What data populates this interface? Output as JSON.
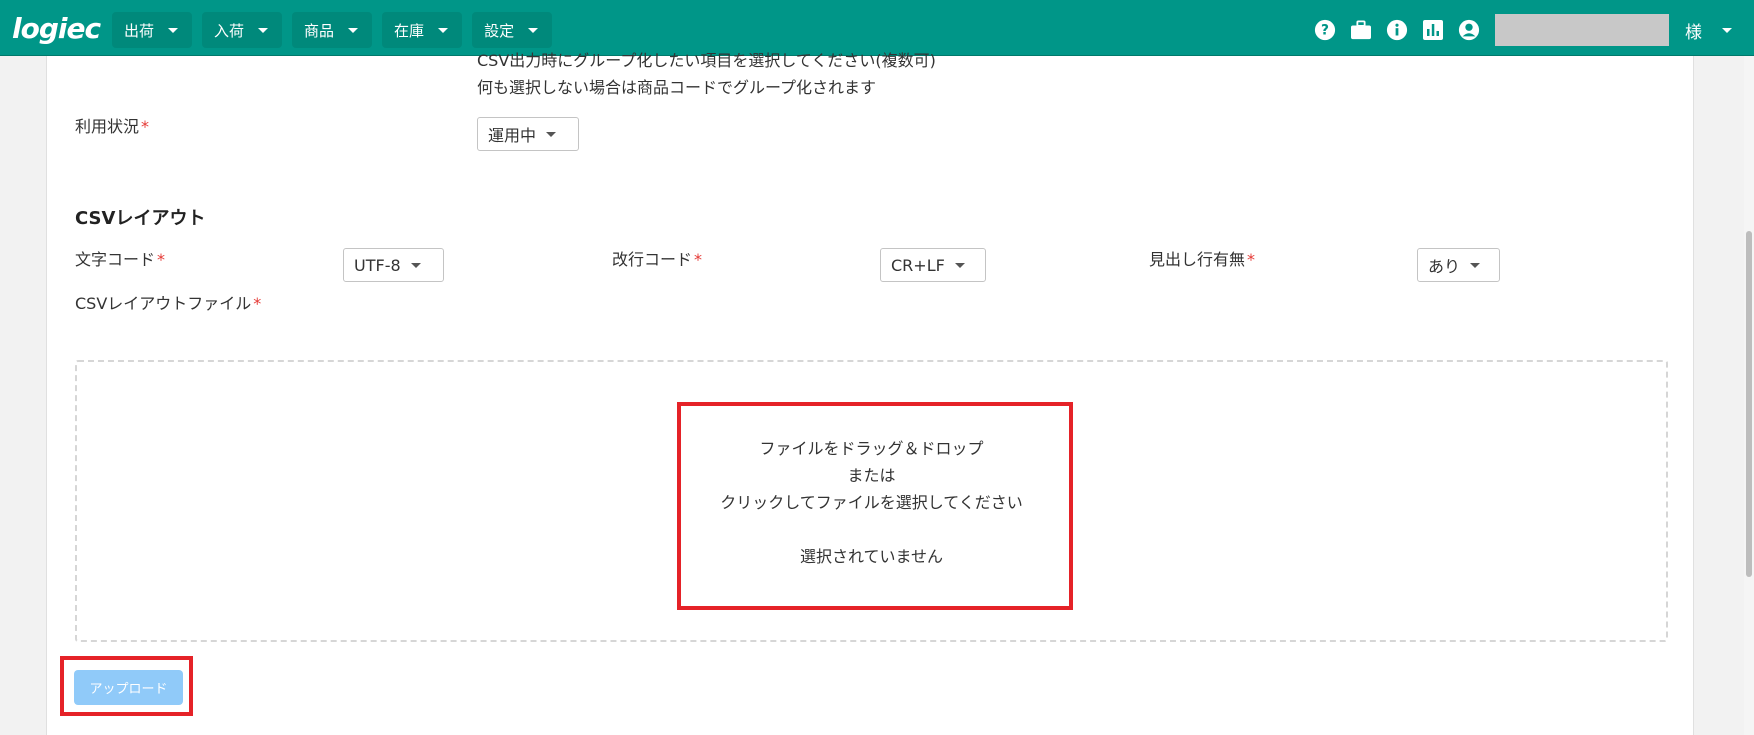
{
  "app": {
    "logo": "logiec"
  },
  "nav": [
    {
      "label": "出荷"
    },
    {
      "label": "入荷"
    },
    {
      "label": "商品"
    },
    {
      "label": "在庫"
    },
    {
      "label": "設定"
    }
  ],
  "header": {
    "icons": [
      "help-icon",
      "briefcase-icon",
      "info-icon",
      "report-icon",
      "account-icon"
    ],
    "user_suffix": "様"
  },
  "form": {
    "group_hint_1": "CSV出力時にグループ化したい項目を選択してください(複数可)",
    "group_hint_2": "何も選択しない場合は商品コードでグループ化されます",
    "status_label": "利用状況",
    "status_value": "運用中",
    "required_mark": "*"
  },
  "csv_layout": {
    "title": "CSVレイアウト",
    "encoding_label": "文字コード",
    "encoding_value": "UTF-8",
    "newline_label": "改行コード",
    "newline_value": "CR+LF",
    "header_row_label": "見出し行有無",
    "header_row_value": "あり",
    "file_label": "CSVレイアウトファイル"
  },
  "dropzone": {
    "line1": "ファイルをドラッグ＆ドロップ",
    "line2": "または",
    "line3": "クリックしてファイルを選択してください",
    "status": "選択されていません"
  },
  "upload": {
    "label": "アップロード",
    "disabled": true
  },
  "colors": {
    "header": "#009688",
    "highlight": "#e52228",
    "required": "#e53935",
    "button_disabled": "#90caf9"
  }
}
